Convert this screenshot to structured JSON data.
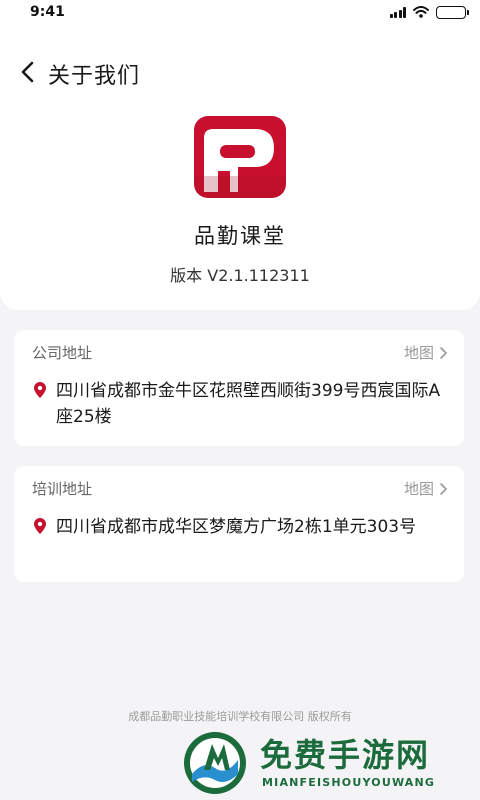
{
  "status_bar": {
    "time": "9:41",
    "battery_level": 1.0
  },
  "nav": {
    "title": "关于我们",
    "back_icon": "chevron-left-icon"
  },
  "app": {
    "name": "品勤课堂",
    "version": "版本 V2.1.112311",
    "brand_color": "#c8102e"
  },
  "addresses": [
    {
      "label": "公司地址",
      "map_label": "地图",
      "address": "四川省成都市金牛区花照壁西顺街399号西宸国际A座25楼"
    },
    {
      "label": "培训地址",
      "map_label": "地图",
      "address": "四川省成都市成华区梦魔方广场2栋1单元303号"
    }
  ],
  "footer": {
    "copyright": "成都品勤职业技能培训学校有限公司 版权所有"
  },
  "watermark": {
    "title": "免费手游网",
    "subtitle": "MIANFEISHOUYOUWANG",
    "color": "#1c6b3c"
  }
}
